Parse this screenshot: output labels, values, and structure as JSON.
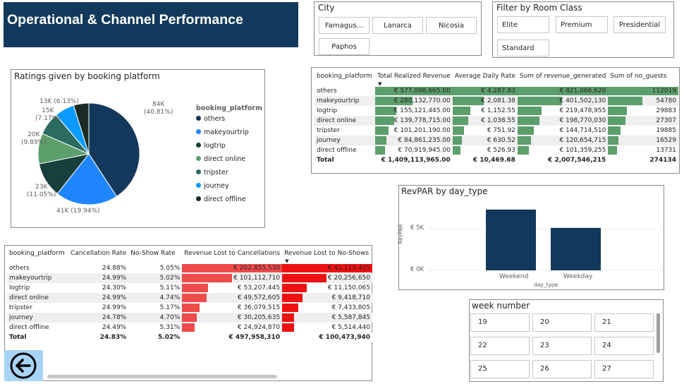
{
  "header": {
    "title": "Operational & Channel Performance"
  },
  "city_slicer": {
    "title": "City",
    "options": [
      "Famagus...",
      "Lanarca",
      "Nicosia",
      "Paphos"
    ]
  },
  "room_slicer": {
    "title": "Filter by Room Class",
    "options": [
      "Elite",
      "Premium",
      "Presidential",
      "Standard"
    ]
  },
  "ratings_pie": {
    "title": "Ratings given by booking platform",
    "legend_title": "booking_platform",
    "labels": [
      "84K\n(40.81%)",
      "41K (19.94%)",
      "23K\n(11.05%)",
      "20K\n(9.89%)",
      "15K\n(7.17%)",
      "13K (6.13%)"
    ]
  },
  "chart_data": [
    {
      "type": "pie",
      "title": "Ratings given by booking platform",
      "legend_title": "booking_platform",
      "categories": [
        "others",
        "makeyourtrip",
        "logtrip",
        "direct online",
        "tripster",
        "journey",
        "direct offline"
      ],
      "values": [
        84000,
        41000,
        23000,
        20000,
        15000,
        13000,
        10000
      ],
      "percent": [
        40.81,
        19.94,
        11.05,
        9.89,
        7.17,
        6.13,
        5.01
      ],
      "colors": [
        "#12395c",
        "#1f86ff",
        "#173f3c",
        "#5c9e6c",
        "#2b6b60",
        "#0b9bff",
        "#1b2b23"
      ]
    },
    {
      "type": "bar",
      "title": "RevPAR by day_type",
      "xlabel": "day_type",
      "ylabel": "RevPAR",
      "categories": [
        "Weekend",
        "Weekday"
      ],
      "values": [
        7300,
        5100
      ],
      "ylim": [
        0,
        7800
      ],
      "yticks": [
        "€ 0K",
        "€ 5K"
      ],
      "color": "#12395c"
    }
  ],
  "revpar": {
    "title": "RevPAR by day_type",
    "xlabel": "day_type",
    "ylabel": "RevPAR",
    "ytick0": "€ 0K",
    "ytick5": "€ 5K",
    "cat0": "Weekend",
    "cat1": "Weekday"
  },
  "revenue_table": {
    "columns": [
      "booking_platform",
      "Total Realized Revenue",
      "Average Daily Rate",
      "Sum of revenue_generated",
      "Sum of no_guests"
    ],
    "rows": [
      [
        "others",
        "€ 577,098,665.00",
        "€ 4,287.83",
        "€ 821,066,620",
        "112019"
      ],
      [
        "makeyourtrip",
        "€ 280,132,770.00",
        "€ 2,081.38",
        "€ 401,502,130",
        "54780"
      ],
      [
        "logtrip",
        "€ 155,121,445.00",
        "€ 1,152.55",
        "€ 219,478,955",
        "29883"
      ],
      [
        "direct online",
        "€ 139,778,715.00",
        "€ 1,038.55",
        "€ 198,770,030",
        "27307"
      ],
      [
        "tripster",
        "€ 101,201,190.00",
        "€ 751.92",
        "€ 144,714,510",
        "19885"
      ],
      [
        "journey",
        "€ 84,861,235.00",
        "€ 630.52",
        "€ 120,654,715",
        "16529"
      ],
      [
        "direct offline",
        "€ 70,919,945.00",
        "€ 526.93",
        "€ 101,359,255",
        "13731"
      ]
    ],
    "total": [
      "Total",
      "€ 1,409,113,965.00",
      "€ 10,469.68",
      "€ 2,007,546,215",
      "274134"
    ],
    "bar_fractions": [
      [
        1.0,
        0.485,
        0.269,
        0.242,
        0.175,
        0.147,
        0.123
      ],
      [
        1.0,
        0.485,
        0.269,
        0.242,
        0.175,
        0.147,
        0.123
      ],
      [
        1.0,
        0.489,
        0.267,
        0.242,
        0.176,
        0.147,
        0.123
      ],
      [
        1.0,
        0.489,
        0.267,
        0.244,
        0.178,
        0.148,
        0.123
      ]
    ]
  },
  "loss_table": {
    "columns": [
      "booking_platform",
      "Cancellation Rate",
      "No-Show Rate",
      "Revenue Lost to Cancellations",
      "Revenue Lost to No-Shows"
    ],
    "rows": [
      [
        "others",
        "24.88%",
        "5.05%",
        "€ 202,855,530",
        "€ 41,113,425"
      ],
      [
        "makeyourtrip",
        "24.99%",
        "5.02%",
        "€ 101,112,710",
        "€ 20,256,650"
      ],
      [
        "logtrip",
        "24.30%",
        "5.11%",
        "€ 53,207,445",
        "€ 11,150,065"
      ],
      [
        "direct online",
        "24.99%",
        "4.74%",
        "€ 49,572,605",
        "€ 9,418,710"
      ],
      [
        "tripster",
        "24.99%",
        "5.17%",
        "€ 36,079,515",
        "€ 7,433,805"
      ],
      [
        "journey",
        "24.78%",
        "4.70%",
        "€ 30,205,635",
        "€ 5,587,845"
      ],
      [
        "direct offline",
        "24.49%",
        "5.31%",
        "€ 24,924,870",
        "€ 5,514,440"
      ]
    ],
    "total": [
      "Total",
      "24.83%",
      "5.02%",
      "€ 497,958,310",
      "€ 100,473,940"
    ],
    "bar_fractions": [
      [
        1.0,
        0.498,
        0.262,
        0.244,
        0.178,
        0.149,
        0.123
      ],
      [
        1.0,
        0.493,
        0.271,
        0.229,
        0.181,
        0.136,
        0.134
      ]
    ]
  },
  "week_slicer": {
    "title": "week number",
    "weeks": [
      "19",
      "20",
      "21",
      "22",
      "23",
      "24",
      "25",
      "26",
      "27"
    ]
  },
  "back_button": {
    "icon": "arrow-left-icon"
  }
}
